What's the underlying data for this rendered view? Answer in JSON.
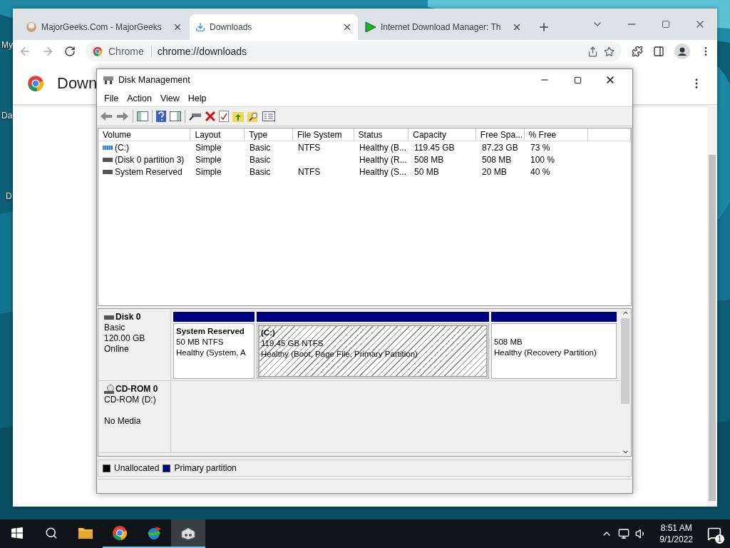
{
  "desktop": {
    "icons": [
      {
        "label": "My"
      },
      {
        "label": "Da"
      },
      {
        "label": "D"
      }
    ]
  },
  "browser": {
    "tabs": [
      {
        "title": "MajorGeeks.Com - MajorGeeks",
        "kind": "site",
        "selected": false
      },
      {
        "title": "Downloads",
        "kind": "downloads",
        "selected": true
      },
      {
        "title": "Internet Download Manager: Th",
        "kind": "idm",
        "selected": false
      }
    ],
    "address": {
      "site_chip": "Chrome",
      "url": "chrome://downloads"
    },
    "page_heading": "Down"
  },
  "disk_management": {
    "title": "Disk Management",
    "menu": [
      "File",
      "Action",
      "View",
      "Help"
    ],
    "volume_table": {
      "columns": [
        "Volume",
        "Layout",
        "Type",
        "File System",
        "Status",
        "Capacity",
        "Free Spa...",
        "% Free"
      ],
      "rows": [
        {
          "kind": "boot",
          "volume": "(C:)",
          "layout": "Simple",
          "type": "Basic",
          "file_system": "NTFS",
          "status": "Healthy (B...",
          "capacity": "119.45 GB",
          "free_space": "87.23 GB",
          "percent_free": "73 %"
        },
        {
          "kind": "plain",
          "volume": "(Disk 0 partition 3)",
          "layout": "Simple",
          "type": "Basic",
          "status": "Healthy (R...",
          "capacity": "508 MB",
          "free_space": "508 MB",
          "percent_free": "100 %"
        },
        {
          "kind": "plain",
          "volume": "System Reserved",
          "layout": "Simple",
          "type": "Basic",
          "file_system": "NTFS",
          "status": "Healthy (S...",
          "capacity": "50 MB",
          "free_space": "20 MB",
          "percent_free": "40 %"
        }
      ]
    },
    "disks": [
      {
        "kind": "disk",
        "name": "Disk 0",
        "type": "Basic",
        "size": "120.00 GB",
        "status": "Online",
        "partitions": [
          {
            "name": "System Reserved",
            "size": "50 MB NTFS",
            "status": "Healthy (System, A",
            "color": "#000080",
            "selected": false
          },
          {
            "name": "(C:)",
            "size": "119.45 GB NTFS",
            "status": "Healthy (Boot, Page File, Primary Partition)",
            "color": "#000080",
            "selected": true
          },
          {
            "size": "508 MB",
            "status": "Healthy (Recovery Partition)",
            "color": "#000080",
            "selected": false
          }
        ]
      },
      {
        "kind": "cdrom",
        "name": "CD-ROM 0",
        "type": "CD-ROM (D:)",
        "status": "No Media"
      }
    ],
    "legend": [
      {
        "label": "Unallocated",
        "color": "#000000"
      },
      {
        "label": "Primary partition",
        "color": "#000080"
      }
    ]
  },
  "taskbar": {
    "apps": [
      {
        "kind": "explorer",
        "running": false,
        "selected": false
      },
      {
        "kind": "chrome",
        "running": true,
        "selected": false
      },
      {
        "kind": "idm",
        "running": true,
        "selected": false
      },
      {
        "kind": "disk",
        "running": true,
        "selected": true
      }
    ],
    "time": "8:51 AM",
    "date": "9/1/2022",
    "notifications": "1"
  }
}
